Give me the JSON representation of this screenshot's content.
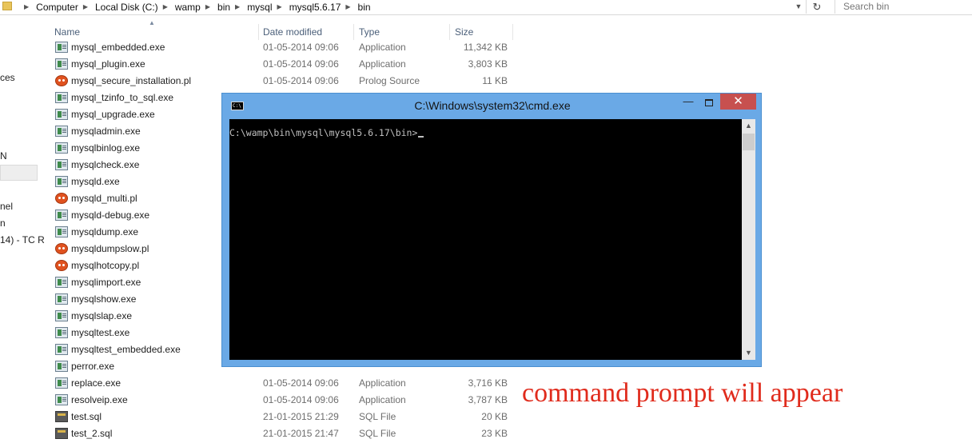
{
  "breadcrumb": [
    "Computer",
    "Local Disk (C:)",
    "wamp",
    "bin",
    "mysql",
    "mysql5.6.17",
    "bin"
  ],
  "search": {
    "placeholder": "Search bin"
  },
  "nav_fragments": [
    "ces",
    "N",
    "nel",
    "n",
    "14) - TC R"
  ],
  "columns": {
    "name": "Name",
    "date": "Date modified",
    "type": "Type",
    "size": "Size"
  },
  "files": [
    {
      "name": "mysql_embedded.exe",
      "date": "01-05-2014 09:06",
      "type": "Application",
      "size": "11,342 KB",
      "icon": "exe-icon"
    },
    {
      "name": "mysql_plugin.exe",
      "date": "01-05-2014 09:06",
      "type": "Application",
      "size": "3,803 KB",
      "icon": "exe-icon"
    },
    {
      "name": "mysql_secure_installation.pl",
      "date": "01-05-2014 09:06",
      "type": "Prolog Source",
      "size": "11 KB",
      "icon": "perl-icon"
    },
    {
      "name": "mysql_tzinfo_to_sql.exe",
      "date": "",
      "type": "",
      "size": "",
      "icon": "exe-icon"
    },
    {
      "name": "mysql_upgrade.exe",
      "date": "",
      "type": "",
      "size": "",
      "icon": "exe-icon"
    },
    {
      "name": "mysqladmin.exe",
      "date": "",
      "type": "",
      "size": "",
      "icon": "exe-icon"
    },
    {
      "name": "mysqlbinlog.exe",
      "date": "",
      "type": "",
      "size": "",
      "icon": "exe-icon"
    },
    {
      "name": "mysqlcheck.exe",
      "date": "",
      "type": "",
      "size": "",
      "icon": "exe-icon"
    },
    {
      "name": "mysqld.exe",
      "date": "",
      "type": "",
      "size": "",
      "icon": "exe-icon"
    },
    {
      "name": "mysqld_multi.pl",
      "date": "",
      "type": "",
      "size": "",
      "icon": "perl-icon"
    },
    {
      "name": "mysqld-debug.exe",
      "date": "",
      "type": "",
      "size": "",
      "icon": "exe-icon"
    },
    {
      "name": "mysqldump.exe",
      "date": "",
      "type": "",
      "size": "",
      "icon": "exe-icon"
    },
    {
      "name": "mysqldumpslow.pl",
      "date": "",
      "type": "",
      "size": "",
      "icon": "perl-icon"
    },
    {
      "name": "mysqlhotcopy.pl",
      "date": "",
      "type": "",
      "size": "",
      "icon": "perl-icon"
    },
    {
      "name": "mysqlimport.exe",
      "date": "",
      "type": "",
      "size": "",
      "icon": "exe-icon"
    },
    {
      "name": "mysqlshow.exe",
      "date": "",
      "type": "",
      "size": "",
      "icon": "exe-icon"
    },
    {
      "name": "mysqlslap.exe",
      "date": "",
      "type": "",
      "size": "",
      "icon": "exe-icon"
    },
    {
      "name": "mysqltest.exe",
      "date": "",
      "type": "",
      "size": "",
      "icon": "exe-icon"
    },
    {
      "name": "mysqltest_embedded.exe",
      "date": "",
      "type": "",
      "size": "",
      "icon": "exe-icon"
    },
    {
      "name": "perror.exe",
      "date": "",
      "type": "",
      "size": "",
      "icon": "exe-icon"
    },
    {
      "name": "replace.exe",
      "date": "01-05-2014 09:06",
      "type": "Application",
      "size": "3,716 KB",
      "icon": "exe-icon"
    },
    {
      "name": "resolveip.exe",
      "date": "01-05-2014 09:06",
      "type": "Application",
      "size": "3,787 KB",
      "icon": "exe-icon"
    },
    {
      "name": "test.sql",
      "date": "21-01-2015 21:29",
      "type": "SQL File",
      "size": "20 KB",
      "icon": "sql-icon"
    },
    {
      "name": "test_2.sql",
      "date": "21-01-2015 21:47",
      "type": "SQL File",
      "size": "23 KB",
      "icon": "sql-icon"
    }
  ],
  "cmd": {
    "title": "C:\\Windows\\system32\\cmd.exe",
    "icon_text": "C:\\",
    "prompt": "C:\\wamp\\bin\\mysql\\mysql5.6.17\\bin>"
  },
  "annotation": "command prompt will appear",
  "colors": {
    "annotation": "#e02b1c",
    "cmd_frame": "#6aa9e6",
    "close_button": "#c7504f"
  }
}
